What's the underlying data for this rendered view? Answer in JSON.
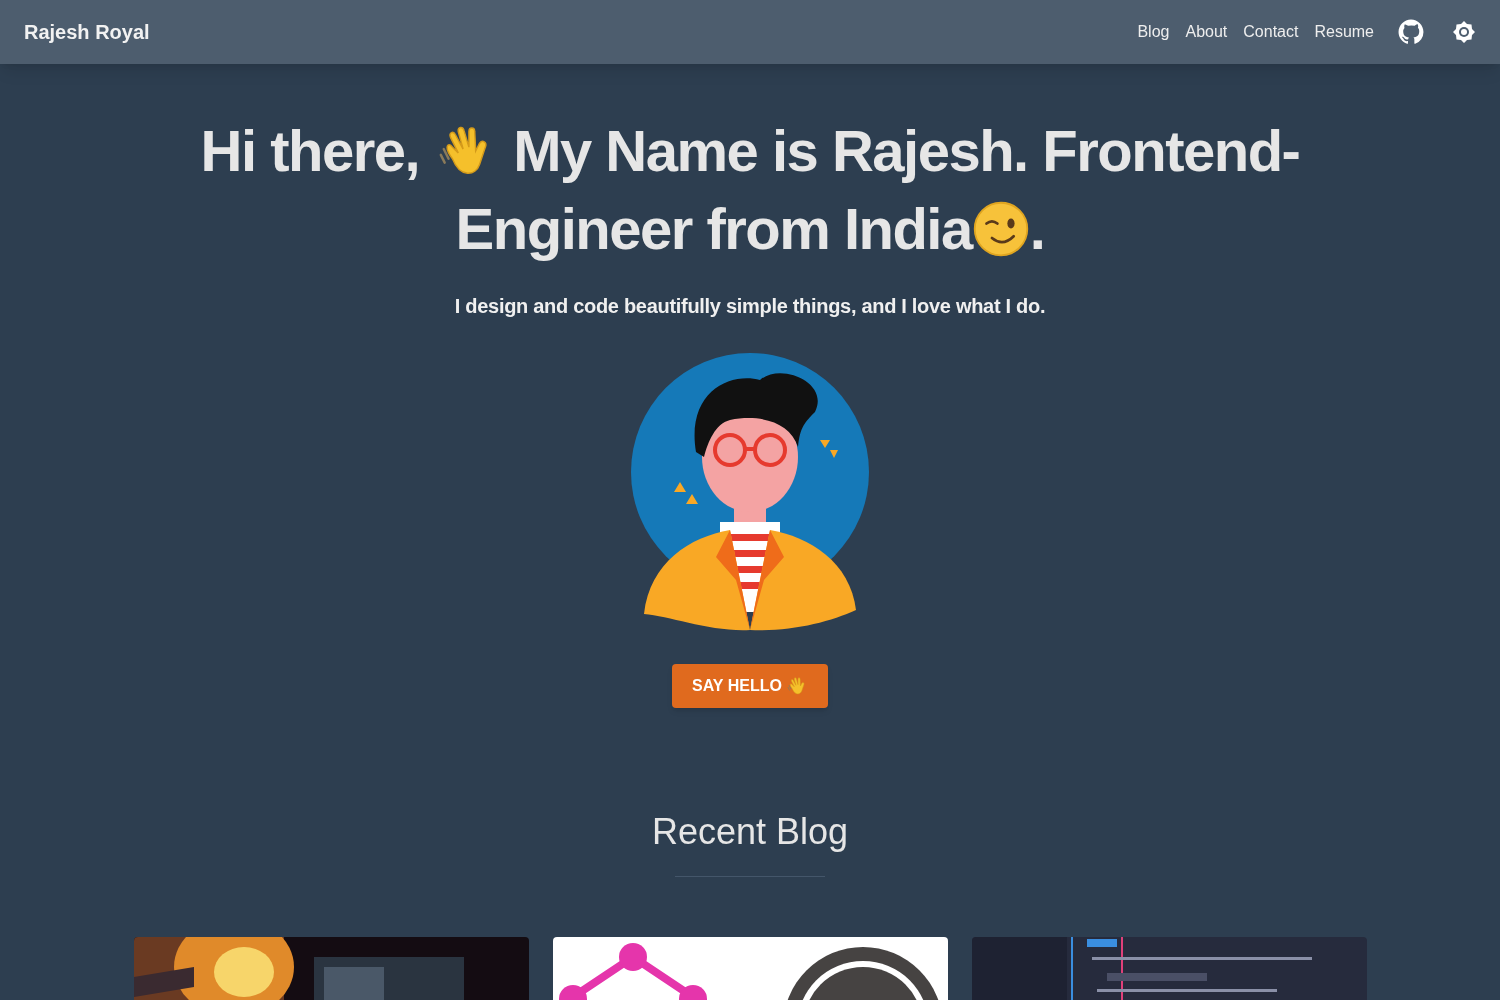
{
  "navbar": {
    "brand": "Rajesh Royal",
    "links": [
      "Blog",
      "About",
      "Contact",
      "Resume"
    ]
  },
  "hero": {
    "heading_start": "Hi there,",
    "heading_line1_end": "My Name is Rajesh. Frontend-",
    "heading_line2": "Engineer from India",
    "heading_end": ".",
    "subtitle": "I design and code beautifully simple things, and I love what I do.",
    "button": "SAY HELLO"
  },
  "recent_blog": {
    "title": "Recent Blog"
  }
}
